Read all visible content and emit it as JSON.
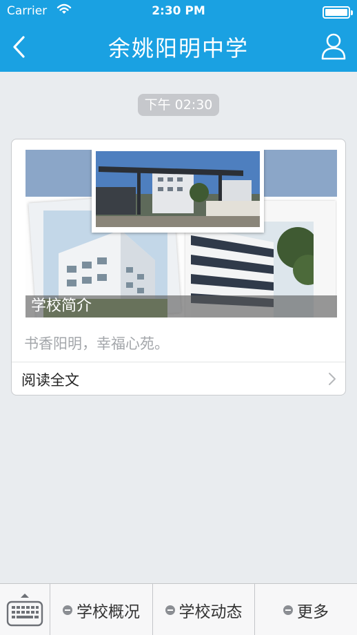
{
  "status_bar": {
    "carrier": "Carrier",
    "time": "2:30 PM"
  },
  "nav": {
    "title": "余姚阳明中学",
    "back_icon": "chevron-left-icon",
    "user_icon": "user-icon"
  },
  "message": {
    "timestamp": "下午 02:30",
    "card": {
      "caption": "学校简介",
      "summary": "书香阳明，幸福心苑。",
      "read_more": "阅读全文"
    }
  },
  "tabbar": {
    "keyboard_icon": "keyboard-icon",
    "items": [
      {
        "label": "学校概况"
      },
      {
        "label": "学校动态"
      },
      {
        "label": "更多"
      }
    ]
  },
  "colors": {
    "accent": "#1aa1e2",
    "background": "#e9ecef"
  }
}
